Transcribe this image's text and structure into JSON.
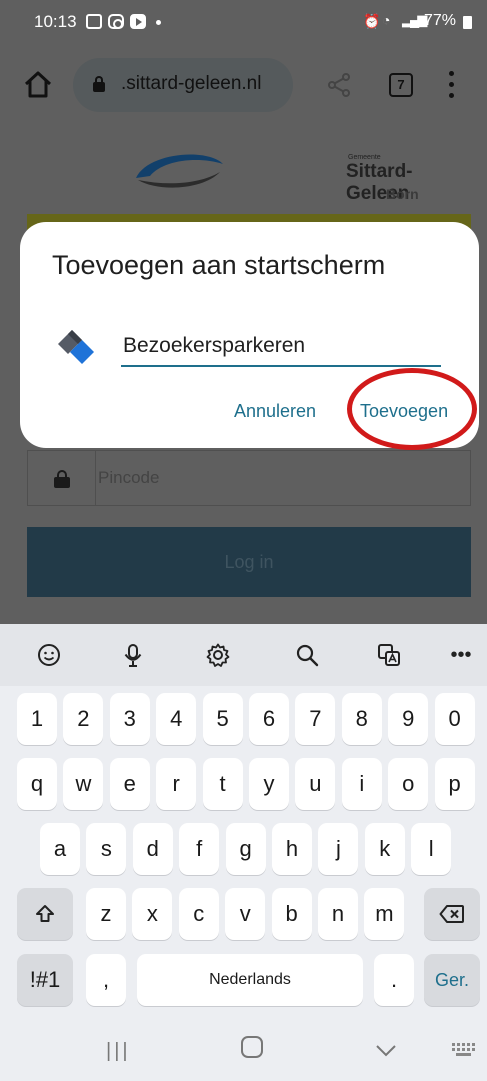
{
  "status_bar": {
    "time": "10:13",
    "battery": "77%"
  },
  "browser": {
    "url": ".sittard-geleen.nl",
    "tab_count": "7"
  },
  "page": {
    "logo_subtitle": "Gemeente",
    "logo_name": "Sittard-Geleen",
    "logo_sub": "Born",
    "pin_placeholder": "Pincode",
    "login_label": "Log in"
  },
  "dialog": {
    "title": "Toevoegen aan startscherm",
    "app_name": "Bezoekersparkeren",
    "cancel_label": "Annuleren",
    "add_label": "Toevoegen"
  },
  "keyboard": {
    "toolbar_icons": [
      "emoji-icon",
      "mic-icon",
      "settings-icon",
      "search-icon",
      "translate-icon",
      "more-icon"
    ],
    "number_row": [
      "1",
      "2",
      "3",
      "4",
      "5",
      "6",
      "7",
      "8",
      "9",
      "0"
    ],
    "row1": [
      "q",
      "w",
      "e",
      "r",
      "t",
      "y",
      "u",
      "i",
      "o",
      "p"
    ],
    "row2": [
      "a",
      "s",
      "d",
      "f",
      "g",
      "h",
      "j",
      "k",
      "l"
    ],
    "row3": [
      "z",
      "x",
      "c",
      "v",
      "b",
      "n",
      "m"
    ],
    "symbols_label": "!#1",
    "comma": ",",
    "space_label": "Nederlands",
    "period": ".",
    "enter_label": "Ger."
  },
  "colors": {
    "accent": "#1e6f8c",
    "highlight": "#d11a1a",
    "login_button": "#223a48"
  }
}
